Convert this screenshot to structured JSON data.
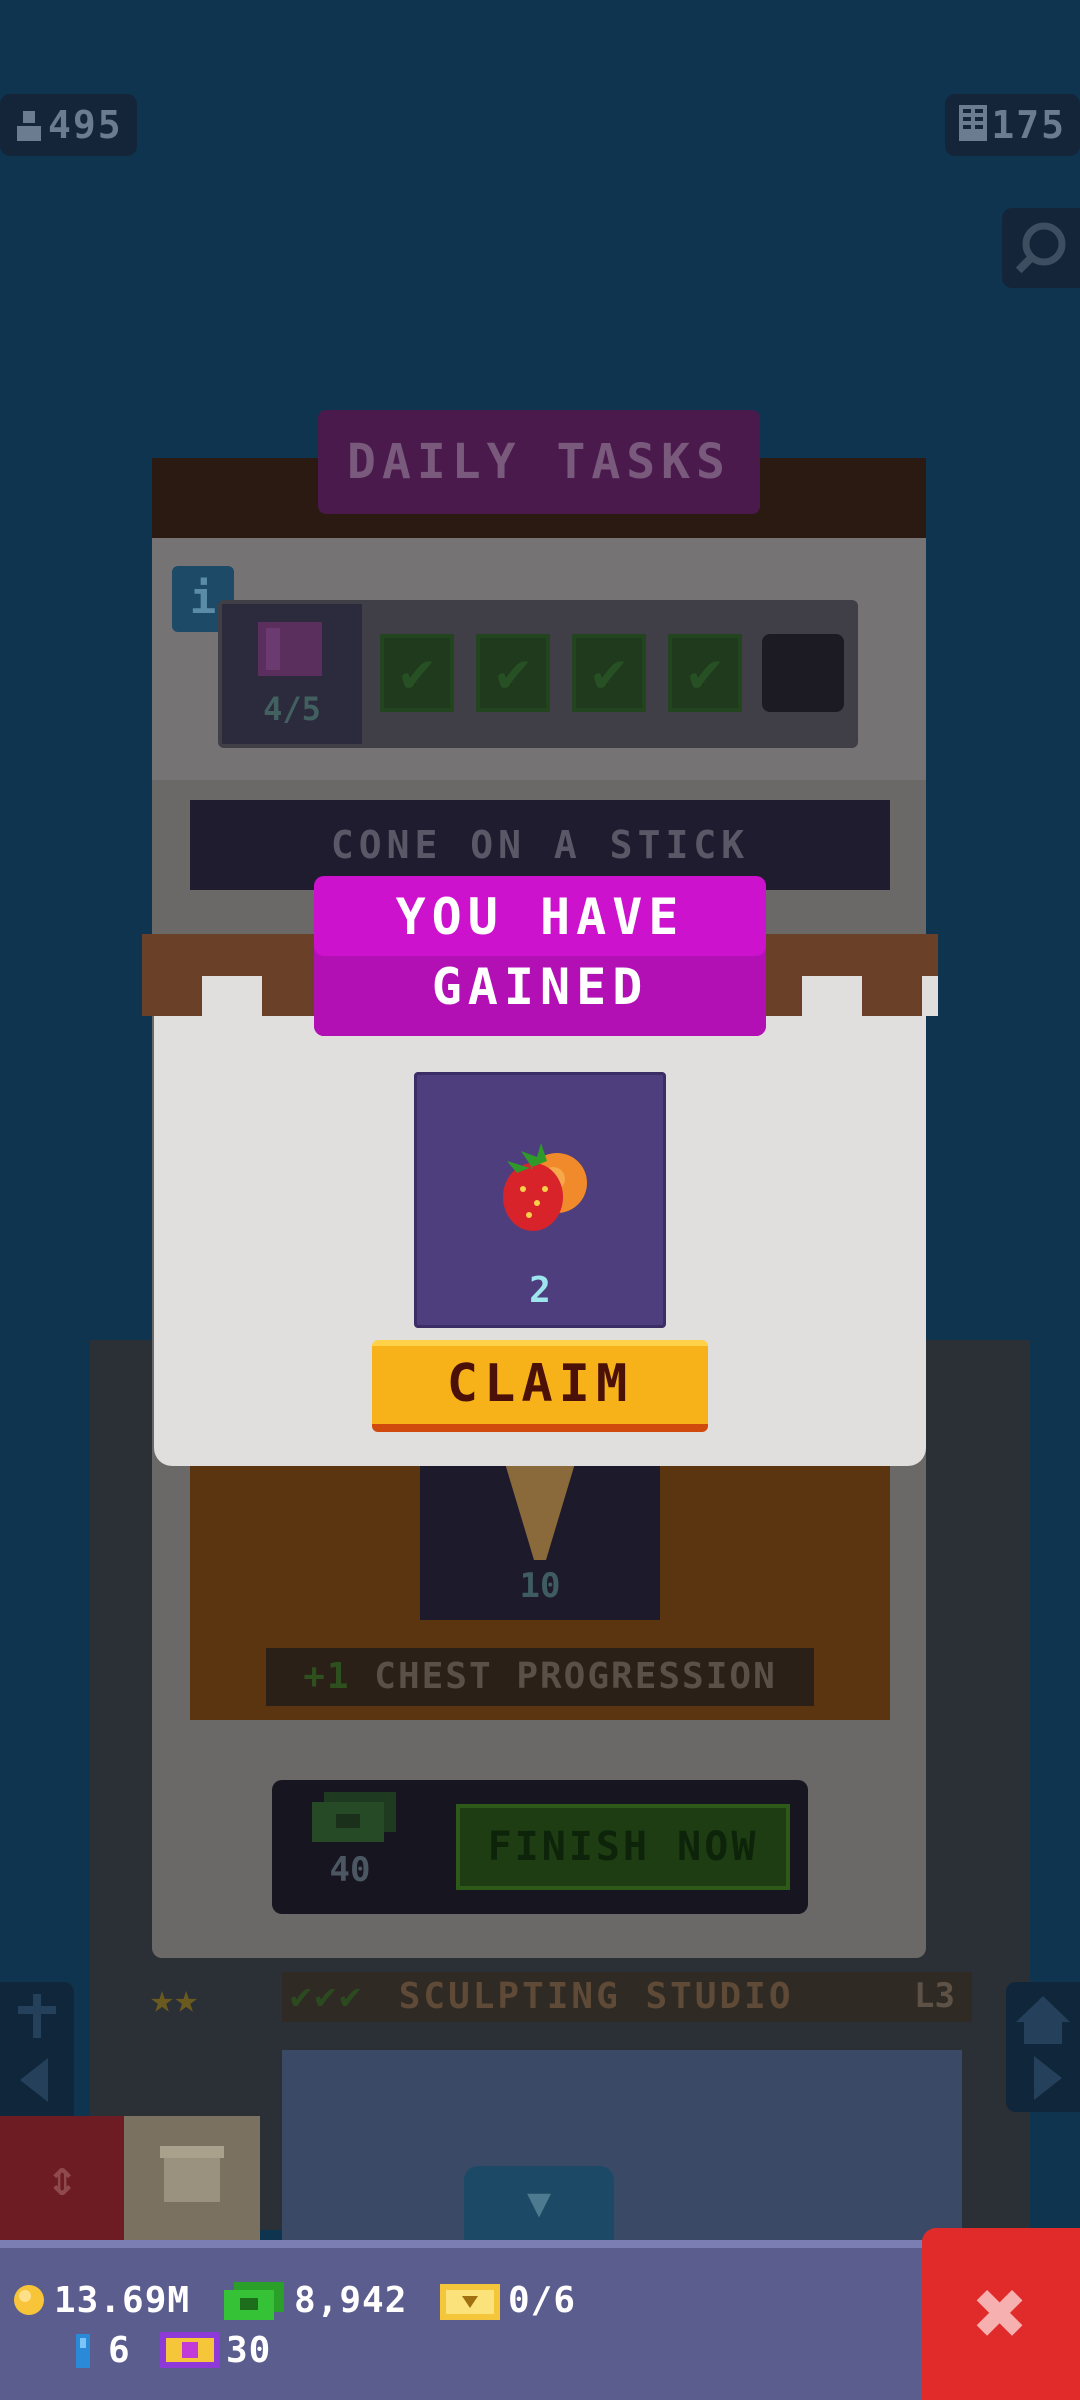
{
  "top_counters": {
    "population": "495",
    "floors": "175"
  },
  "daily_tasks": {
    "title": "DAILY TASKS",
    "info_label": "i",
    "progress_count": "4/5",
    "completed_checks": 4,
    "task_title": "CONE ON A STICK",
    "reward_count": "10",
    "chest_progress_plus": "+1",
    "chest_progress_label": "CHEST PROGRESSION",
    "finish_cost": "40",
    "finish_button": "FINISH NOW"
  },
  "floor": {
    "name": "SCULPTING STUDIO",
    "level": "L3"
  },
  "modal": {
    "title_line1": "YOU HAVE",
    "title_line2": "GAINED",
    "reward_item_icon": "strawberry-orange-icon",
    "reward_quantity": "2",
    "claim_button": "CLAIM"
  },
  "bottom_bar": {
    "coins": "13.69M",
    "bux": "8,942",
    "tickets": "0/6",
    "keys": "6",
    "gold_tickets": "30",
    "close_label": "✖"
  },
  "colors": {
    "background": "#0f3450",
    "modal_banner": "#cc12cc",
    "claim_button": "#f7b21a",
    "close_button": "#e12b2b",
    "bottom_bar": "#5b5d8f"
  }
}
